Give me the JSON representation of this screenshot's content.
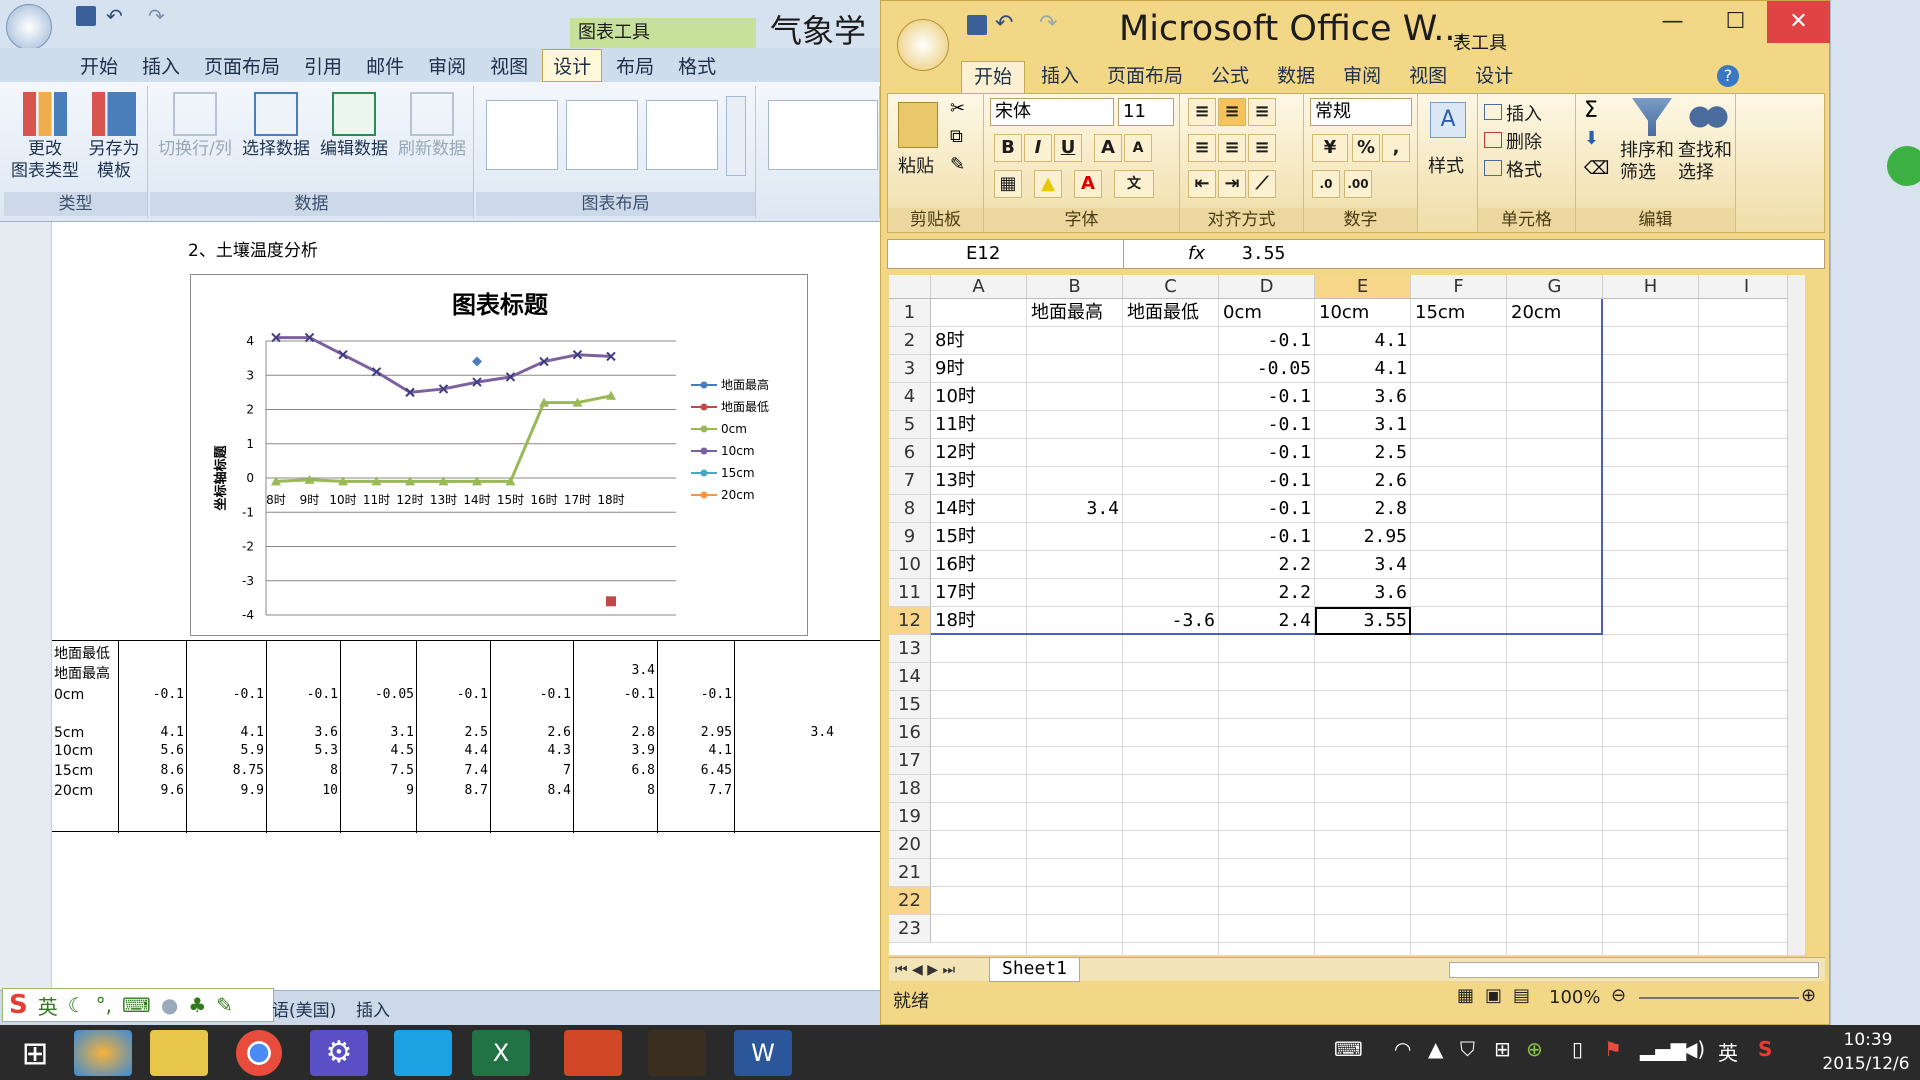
{
  "word": {
    "tool_context_label": "图表工具",
    "title_fragment": "气象学报",
    "tabs": [
      "开始",
      "插入",
      "页面布局",
      "引用",
      "邮件",
      "审阅",
      "视图",
      "设计",
      "布局",
      "格式"
    ],
    "active_tab": "设计",
    "ribbon": {
      "type_group": {
        "label": "类型",
        "change_type": "更改\n图表类型",
        "save_template": "另存为\n模板"
      },
      "data_group": {
        "label": "数据",
        "switch": "切换行/列",
        "select": "选择数据",
        "edit": "编辑数据",
        "refresh": "刷新数据"
      },
      "layout_group": {
        "label": "图表布局"
      }
    },
    "heading": "2、土壤温度分析",
    "status": {
      "language": "语(美国)",
      "insert": "插入"
    }
  },
  "chart_data": {
    "type": "line",
    "title": "图表标题",
    "ylabel": "坐标轴标题",
    "categories": [
      "8时",
      "9时",
      "10时",
      "11时",
      "12时",
      "13时",
      "14时",
      "15时",
      "16时",
      "17时",
      "18时"
    ],
    "ylim": [
      -4,
      4
    ],
    "yticks": [
      4,
      3,
      2,
      1,
      0,
      -1,
      -2,
      -3,
      -4
    ],
    "legend_position": "right",
    "series": [
      {
        "name": "地面最高",
        "color": "#4a7ebb",
        "values": [
          null,
          null,
          null,
          null,
          null,
          null,
          3.4,
          null,
          null,
          null,
          null
        ]
      },
      {
        "name": "地面最低",
        "color": "#be4b48",
        "values": [
          null,
          null,
          null,
          null,
          null,
          null,
          null,
          null,
          null,
          null,
          -3.6
        ]
      },
      {
        "name": "0cm",
        "color": "#98b954",
        "values": [
          -0.1,
          -0.05,
          -0.1,
          -0.1,
          -0.1,
          -0.1,
          -0.1,
          -0.1,
          2.2,
          2.2,
          2.4
        ]
      },
      {
        "name": "10cm",
        "color": "#7d60a0",
        "values": [
          4.1,
          4.1,
          3.6,
          3.1,
          2.5,
          2.6,
          2.8,
          2.95,
          3.4,
          3.6,
          3.55
        ]
      },
      {
        "name": "15cm",
        "color": "#46aac5",
        "values": [
          null,
          null,
          null,
          null,
          null,
          null,
          null,
          null,
          null,
          null,
          null
        ]
      },
      {
        "name": "20cm",
        "color": "#f79646",
        "values": [
          null,
          null,
          null,
          null,
          null,
          null,
          null,
          null,
          null,
          null,
          null
        ]
      }
    ]
  },
  "doc_table": {
    "row_labels": [
      "地面最低",
      "地面最高",
      "0cm",
      "5cm",
      "10cm",
      "15cm",
      "20cm"
    ],
    "rows": {
      "dmzg": [
        "",
        "",
        "",
        "",
        "",
        "",
        "3.4",
        "",
        ""
      ],
      "0cm": [
        "-0.1",
        "-0.1",
        "-0.1",
        "-0.05",
        "-0.1",
        "-0.1",
        "-0.1",
        "-0.1",
        ""
      ],
      "5cm": [
        "4.1",
        "4.1",
        "3.6",
        "3.1",
        "2.5",
        "2.6",
        "2.8",
        "2.95",
        "3.4"
      ],
      "10cm": [
        "5.6",
        "5.9",
        "5.3",
        "4.5",
        "4.4",
        "4.3",
        "3.9",
        "4.1",
        ""
      ],
      "15cm": [
        "8.6",
        "8.75",
        "8",
        "7.5",
        "7.4",
        "7",
        "6.8",
        "6.45",
        ""
      ],
      "20cm": [
        "9.6",
        "9.9",
        "10",
        "9",
        "8.7",
        "8.4",
        "8",
        "7.7",
        ""
      ]
    }
  },
  "excel": {
    "title": "Microsoft Office W...",
    "tool_context_label": "表工具",
    "tabs": [
      "开始",
      "插入",
      "页面布局",
      "公式",
      "数据",
      "审阅",
      "视图",
      "设计"
    ],
    "active_tab": "开始",
    "ribbon": {
      "clipboard": {
        "label": "剪贴板",
        "paste": "粘贴"
      },
      "font": {
        "label": "字体",
        "name": "宋体",
        "size": "11"
      },
      "alignment": {
        "label": "对齐方式"
      },
      "number": {
        "label": "数字",
        "format": "常规"
      },
      "styles": {
        "label": "样式"
      },
      "cells": {
        "label": "单元格",
        "insert": "插入",
        "delete": "删除",
        "format": "格式"
      },
      "editing": {
        "label": "编辑",
        "sort": "排序和\n筛选",
        "find": "查找和\n选择"
      }
    },
    "name_box": "E12",
    "formula_value": "3.55",
    "columns": [
      "A",
      "B",
      "C",
      "D",
      "E",
      "F",
      "G",
      "H",
      "I"
    ],
    "rows": [
      [
        "",
        "地面最高",
        "地面最低",
        "0cm",
        "10cm",
        "15cm",
        "20cm",
        "",
        ""
      ],
      [
        "8时",
        "",
        "",
        "-0.1",
        "4.1",
        "",
        "",
        "",
        ""
      ],
      [
        "9时",
        "",
        "",
        "-0.05",
        "4.1",
        "",
        "",
        "",
        ""
      ],
      [
        "10时",
        "",
        "",
        "-0.1",
        "3.6",
        "",
        "",
        "",
        ""
      ],
      [
        "11时",
        "",
        "",
        "-0.1",
        "3.1",
        "",
        "",
        "",
        ""
      ],
      [
        "12时",
        "",
        "",
        "-0.1",
        "2.5",
        "",
        "",
        "",
        ""
      ],
      [
        "13时",
        "",
        "",
        "-0.1",
        "2.6",
        "",
        "",
        "",
        ""
      ],
      [
        "14时",
        "3.4",
        "",
        "-0.1",
        "2.8",
        "",
        "",
        "",
        ""
      ],
      [
        "15时",
        "",
        "",
        "-0.1",
        "2.95",
        "",
        "",
        "",
        ""
      ],
      [
        "16时",
        "",
        "",
        "2.2",
        "3.4",
        "",
        "",
        "",
        ""
      ],
      [
        "17时",
        "",
        "",
        "2.2",
        "3.6",
        "",
        "",
        "",
        ""
      ],
      [
        "18时",
        "",
        "-3.6",
        "2.4",
        "3.55",
        "",
        "",
        "",
        ""
      ]
    ],
    "row_numbers": [
      "1",
      "2",
      "3",
      "4",
      "5",
      "6",
      "7",
      "8",
      "9",
      "10",
      "11",
      "12",
      "13",
      "14",
      "15",
      "16",
      "17",
      "18",
      "19",
      "20",
      "21",
      "22",
      "23"
    ],
    "sheet_tab": "Sheet1",
    "status_ready": "就绪",
    "zoom": "100%"
  },
  "taskbar": {
    "time": "10:39",
    "date": "2015/12/6",
    "ime": "英",
    "ime_bar_label": "英"
  }
}
